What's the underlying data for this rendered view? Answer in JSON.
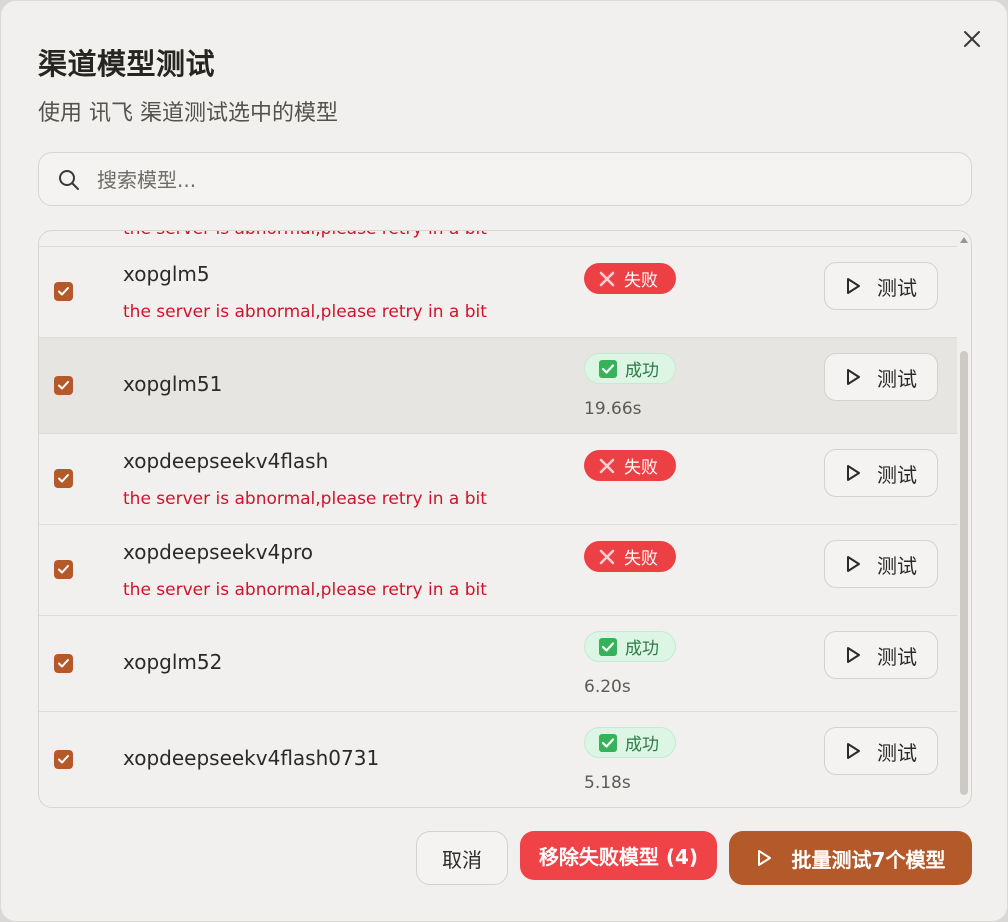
{
  "dialog": {
    "title": "渠道模型测试",
    "subtitle": "使用 讯飞 渠道测试选中的模型",
    "close_icon": "close-icon"
  },
  "search": {
    "placeholder": "搜索模型...",
    "value": "",
    "icon": "search-icon"
  },
  "list": {
    "peek_text": "the server is abnormal,please retry in a bit",
    "rows": [
      {
        "name": "xopglm5",
        "checked": true,
        "status": "失败",
        "status_type": "fail",
        "error": "the server is abnormal,please retry in a bit",
        "time": "",
        "test_label": "测试"
      },
      {
        "name": "xopglm51",
        "checked": true,
        "status": "成功",
        "status_type": "success",
        "error": "",
        "time": "19.66s",
        "test_label": "测试"
      },
      {
        "name": "xopdeepseekv4flash",
        "checked": true,
        "status": "失败",
        "status_type": "fail",
        "error": "the server is abnormal,please retry in a bit",
        "time": "",
        "test_label": "测试"
      },
      {
        "name": "xopdeepseekv4pro",
        "checked": true,
        "status": "失败",
        "status_type": "fail",
        "error": "the server is abnormal,please retry in a bit",
        "time": "",
        "test_label": "测试"
      },
      {
        "name": "xopglm52",
        "checked": true,
        "status": "成功",
        "status_type": "success",
        "error": "",
        "time": "6.20s",
        "test_label": "测试"
      },
      {
        "name": "xopdeepseekv4flash0731",
        "checked": true,
        "status": "成功",
        "status_type": "success",
        "error": "",
        "time": "5.18s",
        "test_label": "测试"
      }
    ]
  },
  "footer": {
    "cancel_label": "取消",
    "remove_failed_label": "移除失败模型 (4)",
    "batch_test_label": "批量测试7个模型"
  },
  "colors": {
    "accent": "#b45a2a",
    "fail": "#ec4045",
    "success_bg": "#dcf5e4",
    "error_text": "#d1122b"
  }
}
